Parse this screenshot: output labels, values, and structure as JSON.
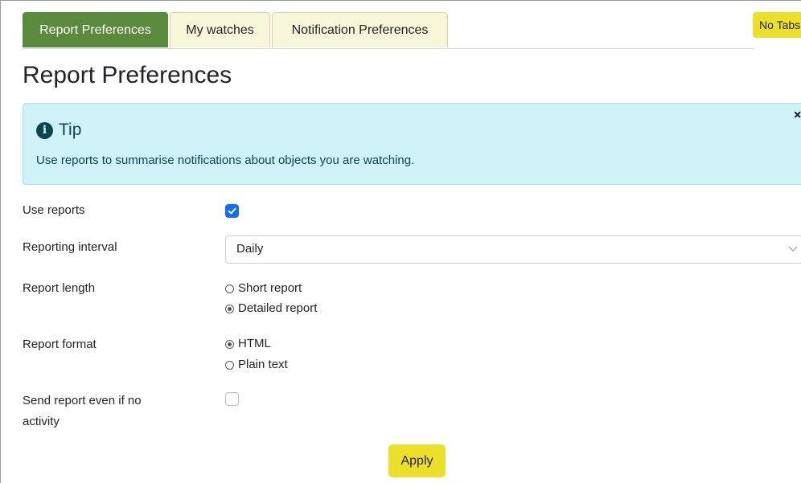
{
  "tabs": [
    {
      "label": "Report Preferences",
      "active": true
    },
    {
      "label": "My watches",
      "active": false
    },
    {
      "label": "Notification Preferences",
      "active": false
    }
  ],
  "no_tabs_label": "No Tabs",
  "page_title": "Report Preferences",
  "tip": {
    "heading": "Tip",
    "text": "Use reports to summarise notifications about objects you are watching.",
    "close": "×"
  },
  "form": {
    "use_reports": {
      "label": "Use reports",
      "checked": true
    },
    "reporting_interval": {
      "label": "Reporting interval",
      "value": "Daily"
    },
    "report_length": {
      "label": "Report length",
      "options": [
        {
          "label": "Short report",
          "selected": false
        },
        {
          "label": "Detailed report",
          "selected": true
        }
      ]
    },
    "report_format": {
      "label": "Report format",
      "options": [
        {
          "label": "HTML",
          "selected": true
        },
        {
          "label": "Plain text",
          "selected": false
        }
      ]
    },
    "send_if_no_activity": {
      "label": "Send report even if no activity",
      "checked": false
    }
  },
  "apply_label": "Apply",
  "colors": {
    "active_tab": "#5a8a3c",
    "inactive_tab": "#f8f6d8",
    "accent_button": "#ede02b",
    "tip_bg": "#cff3f9",
    "checkbox_checked": "#0d6efd"
  }
}
